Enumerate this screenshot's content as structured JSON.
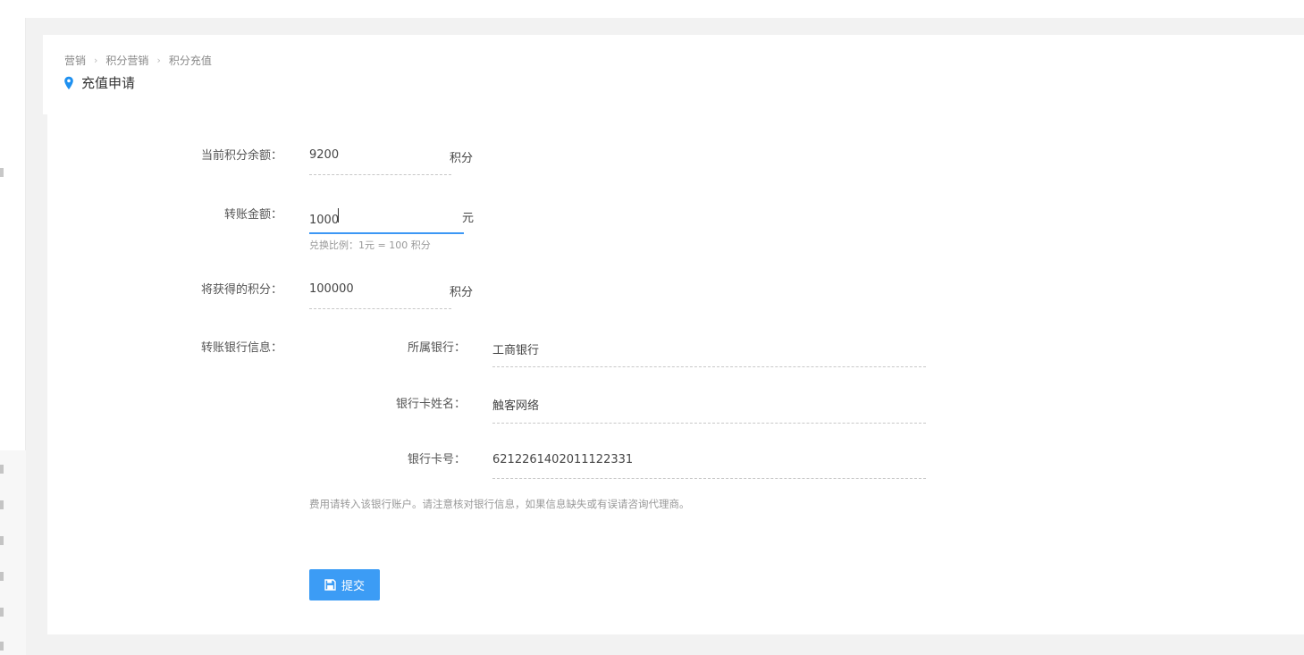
{
  "breadcrumb": [
    "营销",
    "积分营销",
    "积分充值"
  ],
  "breadcrumb_separator": "›",
  "page_title": "充值申请",
  "form": {
    "balance": {
      "label": "当前积分余额：",
      "value": "9200",
      "unit": "积分"
    },
    "amount": {
      "label": "转账金额：",
      "value": "1000",
      "unit": "元",
      "hint": "兑换比例：1元 = 100 积分"
    },
    "points": {
      "label": "将获得的积分：",
      "value": "100000",
      "unit": "积分"
    },
    "bank": {
      "label": "转账银行信息：",
      "bank_name_label": "所属银行：",
      "bank_name": "工商银行",
      "holder_label": "银行卡姓名：",
      "holder": "触客网络",
      "card_label": "银行卡号：",
      "card_number": "6212261402011122331",
      "note": "费用请转入该银行账户。请注意核对银行信息，如果信息缺失或有误请咨询代理商。"
    },
    "submit_label": "提交"
  },
  "colors": {
    "accent": "#3c9cf5",
    "page_bg": "#f2f2f2",
    "card_bg": "#ffffff"
  },
  "icons": {
    "title": "location-pin-icon",
    "submit": "save-icon"
  }
}
